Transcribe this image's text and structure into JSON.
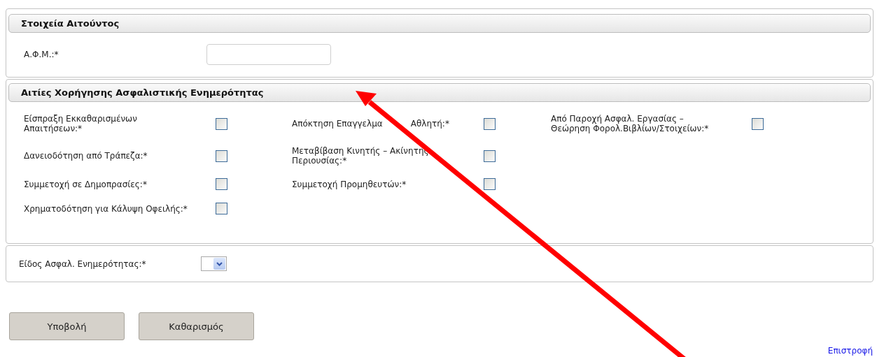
{
  "applicant": {
    "title": "Στοιχεία Αιτούντος",
    "afm": {
      "label": "Α.Φ.Μ.:*"
    }
  },
  "reasons": {
    "title": "Αιτίες Χορήγησης Ασφαλιστικής Ενημερότητας",
    "columns": [
      [
        {
          "label": "Είσπραξη Εκκαθαρισμένων\nΑπαιτήσεων:*",
          "checked": false
        },
        {
          "label": "Δανειοδότηση από Τράπεζα:*",
          "checked": false
        },
        {
          "label": "Συμμετοχή σε Δημοπρασίες:*",
          "checked": false
        },
        {
          "label": "Χρηματοδότηση για Κάλυψη Οφειλής:*",
          "checked": false
        }
      ],
      [
        {
          "label": "Απόκτηση Επαγγελμα",
          "label_tail": "Αθλητή:*",
          "checked": false
        },
        {
          "label": "Μεταβίβαση Κινητής – Ακίνητης\nΠεριουσίας:*",
          "checked": false
        },
        {
          "label": "Συμμετοχή Προμηθευτών:*",
          "checked": false
        }
      ],
      [
        {
          "label": "Από Παροχή Ασφαλ. Εργασίας –\nΘεώρηση Φορολ.Βιβλίων/Στοιχείων:*",
          "checked": false
        }
      ]
    ]
  },
  "certificate_type": {
    "label": "Είδος Ασφαλ. Ενημερότητας:*"
  },
  "buttons": [
    "Υποβολή",
    "Καθαρισμός"
  ],
  "back_link": "Επιστροφή"
}
